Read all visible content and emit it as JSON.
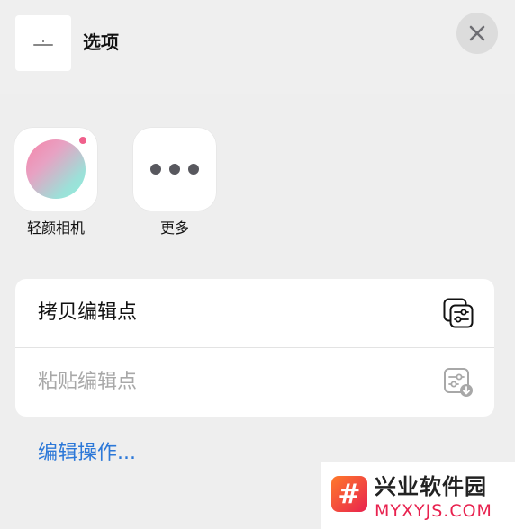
{
  "header": {
    "title": "选项"
  },
  "apps": [
    {
      "label": "轻颜相机",
      "icon": "camera-gradient-icon"
    },
    {
      "label": "更多",
      "icon": "more-dots-icon"
    }
  ],
  "actions": [
    {
      "label": "拷贝编辑点",
      "icon": "copy-edits-icon",
      "enabled": true
    },
    {
      "label": "粘贴编辑点",
      "icon": "paste-edits-icon",
      "enabled": false
    }
  ],
  "footer_link": "编辑操作...",
  "watermark": {
    "logo_char": "#",
    "name": "兴业软件园",
    "url": "MYXYJS.COM"
  },
  "colors": {
    "link": "#2c78d8",
    "disabled_text": "#a8a8a8",
    "background": "#eeeeee"
  }
}
